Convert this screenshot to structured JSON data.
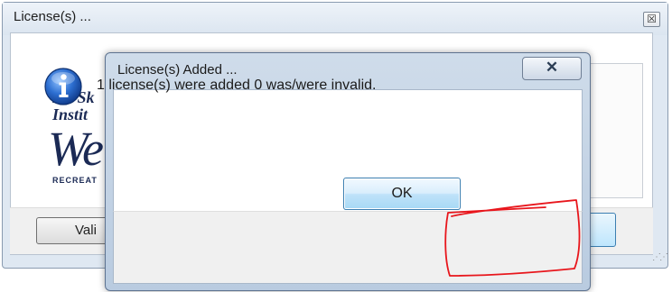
{
  "background_window": {
    "title": "License(s) ...",
    "close_glyph": "☒",
    "logo": {
      "line1": "Ice Sk",
      "line2": "Instit",
      "big": "We",
      "small": "RECREAT"
    },
    "validate_button_label": "Vali"
  },
  "dialog": {
    "title": "License(s) Added ...",
    "close_glyph": "✕",
    "icon": "information-icon",
    "message": "1 license(s) were added 0 was/were invalid.",
    "ok_label": "OK"
  },
  "colors": {
    "annotation_red": "#e8161c",
    "info_blue": "#1f56b4",
    "ok_border": "#3c7fb1"
  }
}
